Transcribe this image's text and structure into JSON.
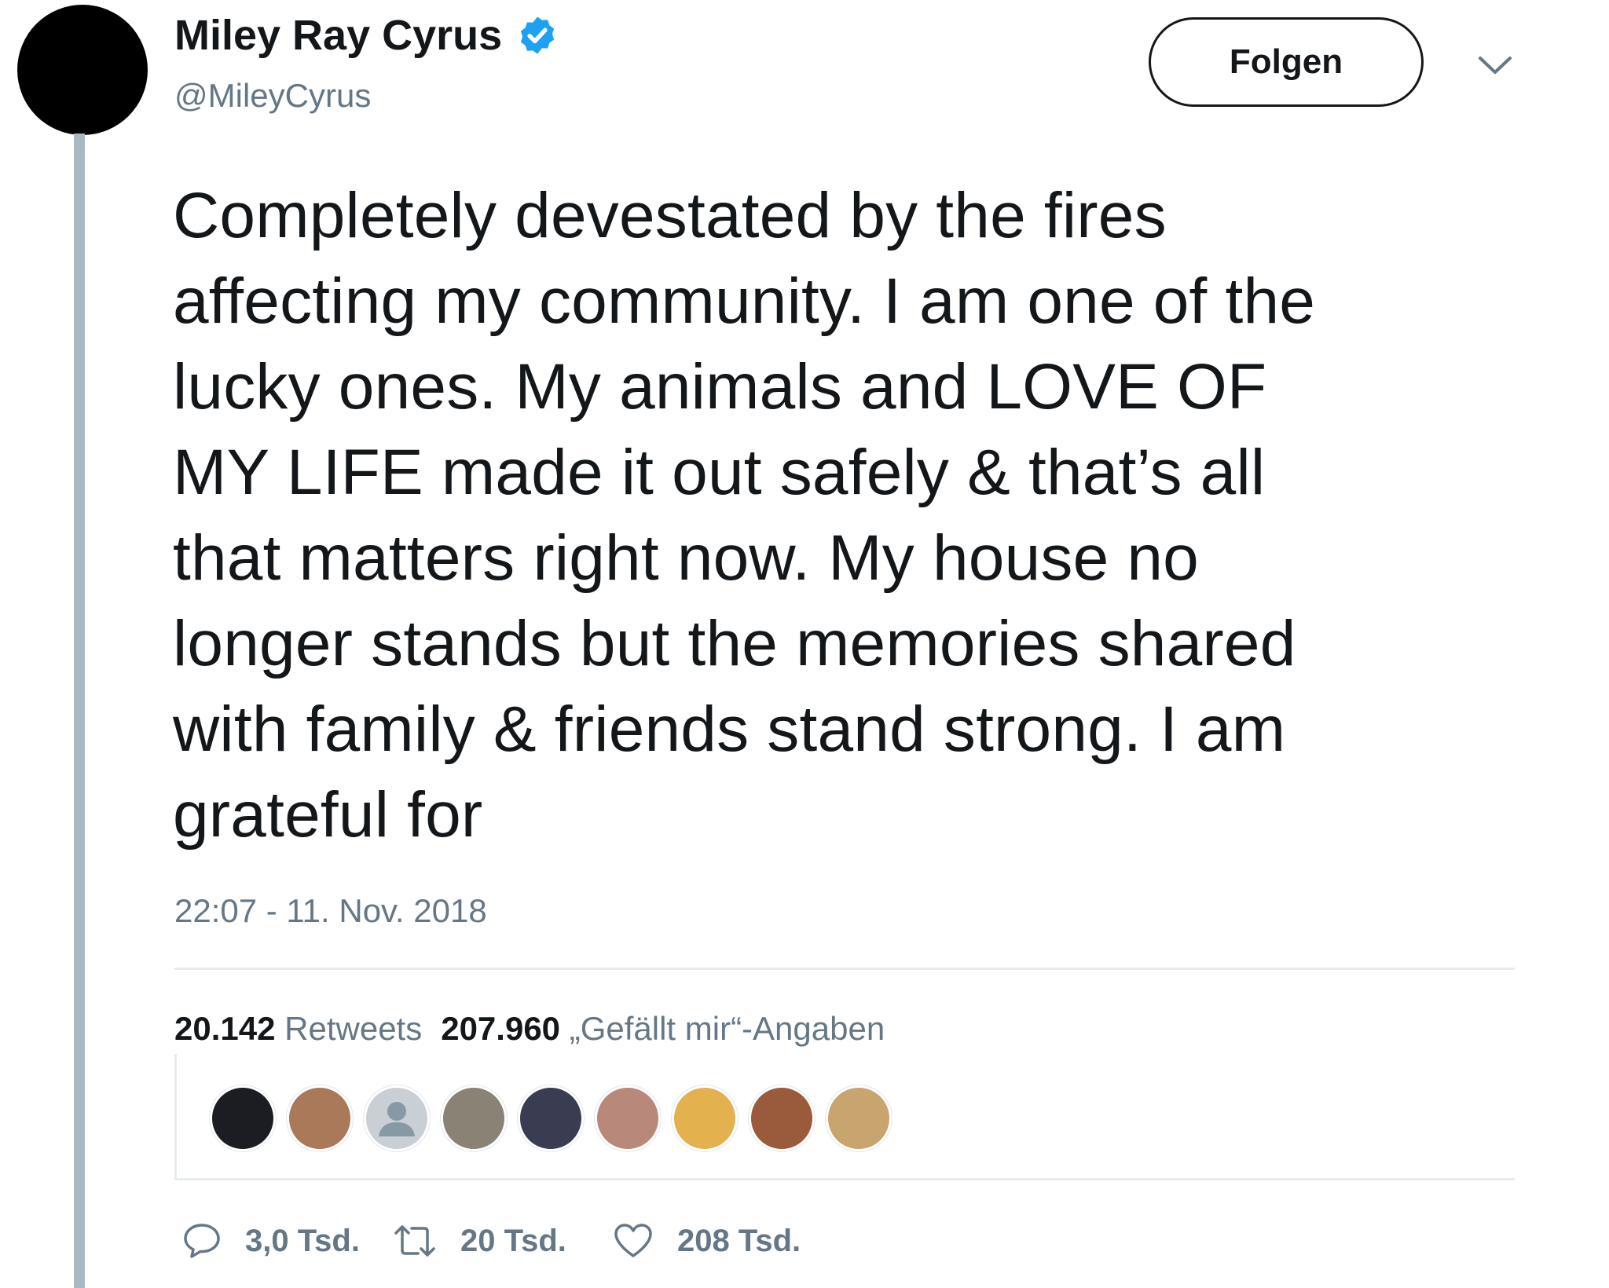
{
  "author": {
    "name": "Miley Ray Cyrus",
    "handle": "@MileyCyrus",
    "verified": true,
    "verified_color": "#1da1f2"
  },
  "follow_button": {
    "label": "Folgen"
  },
  "tweet": {
    "text": "Completely devestated by the fires\naffecting my community. I am one of the\nlucky ones. My animals and LOVE OF\nMY LIFE made it out safely & that’s all\nthat matters right now. My house no\nlonger stands but the memories shared\nwith family & friends stand strong. I am\ngrateful for",
    "timestamp": "22:07 - 11. Nov. 2018"
  },
  "stats": {
    "retweets_count": "20.142",
    "retweets_label": "Retweets",
    "likes_count": "207.960",
    "likes_label": "„Gefällt mir“-Angaben"
  },
  "liker_avatars": [
    {
      "color": "#1b1d22"
    },
    {
      "color": "#a9795a"
    },
    {
      "color": "#c9cfd4",
      "icon": "default-person-icon"
    },
    {
      "color": "#8a8275"
    },
    {
      "color": "#3a3d52"
    },
    {
      "color": "#b8887a"
    },
    {
      "color": "#e3b24f"
    },
    {
      "color": "#9a5a3c"
    },
    {
      "color": "#c8a46e"
    }
  ],
  "actions": {
    "replies": "3,0 Tsd.",
    "retweets": "20 Tsd.",
    "likes": "208 Tsd."
  }
}
